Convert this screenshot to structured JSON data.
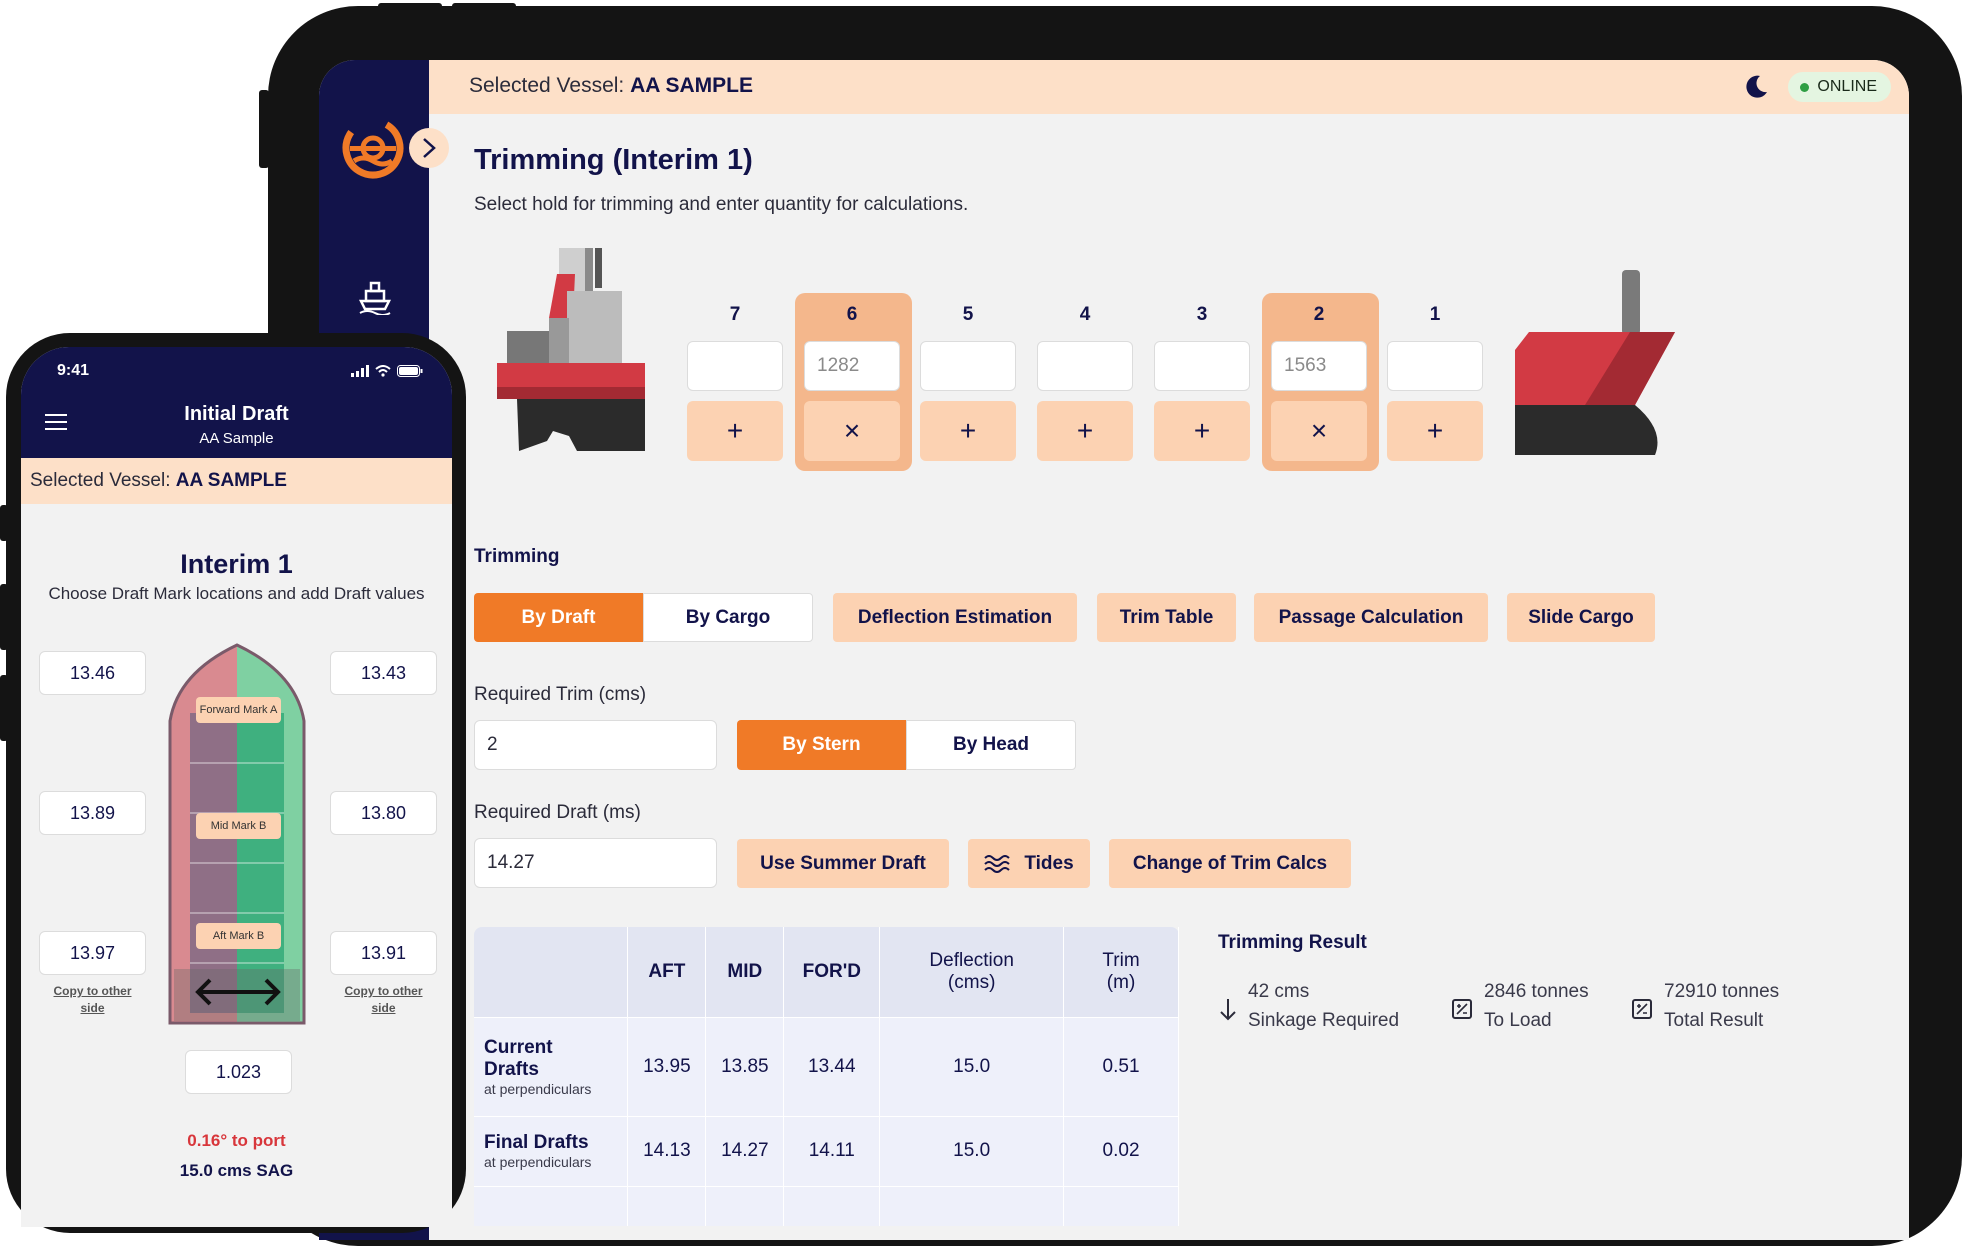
{
  "tablet": {
    "topbar": {
      "vessel_prefix": "Selected Vessel:",
      "vessel_name": "AA SAMPLE",
      "status": "ONLINE"
    },
    "page": {
      "title": "Trimming (Interim 1)",
      "subtitle": "Select hold for trimming and enter quantity for calculations."
    },
    "holds": [
      {
        "number": "7",
        "value": "",
        "selected": false,
        "action": "+"
      },
      {
        "number": "6",
        "value": "1282",
        "selected": true,
        "action": "×"
      },
      {
        "number": "5",
        "value": "",
        "selected": false,
        "action": "+"
      },
      {
        "number": "4",
        "value": "",
        "selected": false,
        "action": "+"
      },
      {
        "number": "3",
        "value": "",
        "selected": false,
        "action": "+"
      },
      {
        "number": "2",
        "value": "1563",
        "selected": true,
        "action": "×"
      },
      {
        "number": "1",
        "value": "",
        "selected": false,
        "action": "+"
      }
    ],
    "trimming": {
      "label": "Trimming",
      "tabs": {
        "by_draft": "By Draft",
        "by_cargo": "By Cargo"
      },
      "actions": {
        "deflection": "Deflection Estimation",
        "trim_table": "Trim Table",
        "passage": "Passage Calculation",
        "slide": "Slide Cargo"
      }
    },
    "required_trim": {
      "label": "Required Trim (cms)",
      "value": "2",
      "by_stern": "By Stern",
      "by_head": "By Head"
    },
    "required_draft": {
      "label": "Required Draft (ms)",
      "value": "14.27",
      "summer": "Use Summer Draft",
      "tides": "Tides",
      "change_calcs": "Change of Trim Calcs"
    },
    "table": {
      "headers": {
        "aft": "AFT",
        "mid": "MID",
        "ford": "FOR'D",
        "defl_1": "Deflection",
        "defl_2": "(cms)",
        "trim_1": "Trim",
        "trim_2": "(m)"
      },
      "rows": [
        {
          "name_1": "Current",
          "name_2": "Drafts",
          "sub": "at perpendiculars",
          "aft": "13.95",
          "mid": "13.85",
          "ford": "13.44",
          "deflection": "15.0",
          "trim": "0.51"
        },
        {
          "name_1": "Final Drafts",
          "name_2": "",
          "sub": "at perpendiculars",
          "aft": "14.13",
          "mid": "14.27",
          "ford": "14.11",
          "deflection": "15.0",
          "trim": "0.02"
        }
      ]
    },
    "result": {
      "title": "Trimming Result",
      "items": [
        {
          "value": "42 cms",
          "label": "Sinkage Required",
          "icon": "arrow-down-icon"
        },
        {
          "value": "2846 tonnes",
          "label": "To Load",
          "icon": "calculator-icon"
        },
        {
          "value": "72910 tonnes",
          "label": "Total Result",
          "icon": "calculator-icon"
        }
      ]
    },
    "colors": {
      "navy": "#12134a",
      "orange": "#f07a27",
      "peach": "#fcd2b2",
      "topbar": "#fde0c8"
    }
  },
  "phone": {
    "status": {
      "time": "9:41"
    },
    "header": {
      "title": "Initial Draft",
      "subtitle": "AA Sample"
    },
    "vessel_prefix": "Selected Vessel:",
    "vessel_name": "AA SAMPLE",
    "interim": {
      "title": "Interim 1",
      "subtitle": "Choose Draft Mark locations and add Draft values"
    },
    "drafts": {
      "port_fwd": "13.46",
      "stbd_fwd": "13.43",
      "port_mid": "13.89",
      "stbd_mid": "13.80",
      "port_aft": "13.97",
      "stbd_aft": "13.91"
    },
    "marks": {
      "forward": "Forward Mark A",
      "mid": "Mid Mark B",
      "aft": "Aft Mark B"
    },
    "copy_link_1": "Copy to other",
    "copy_link_2": "side",
    "density": "1.023",
    "list_text": "0.16° to port",
    "sag_text": "15.0 cms SAG"
  }
}
